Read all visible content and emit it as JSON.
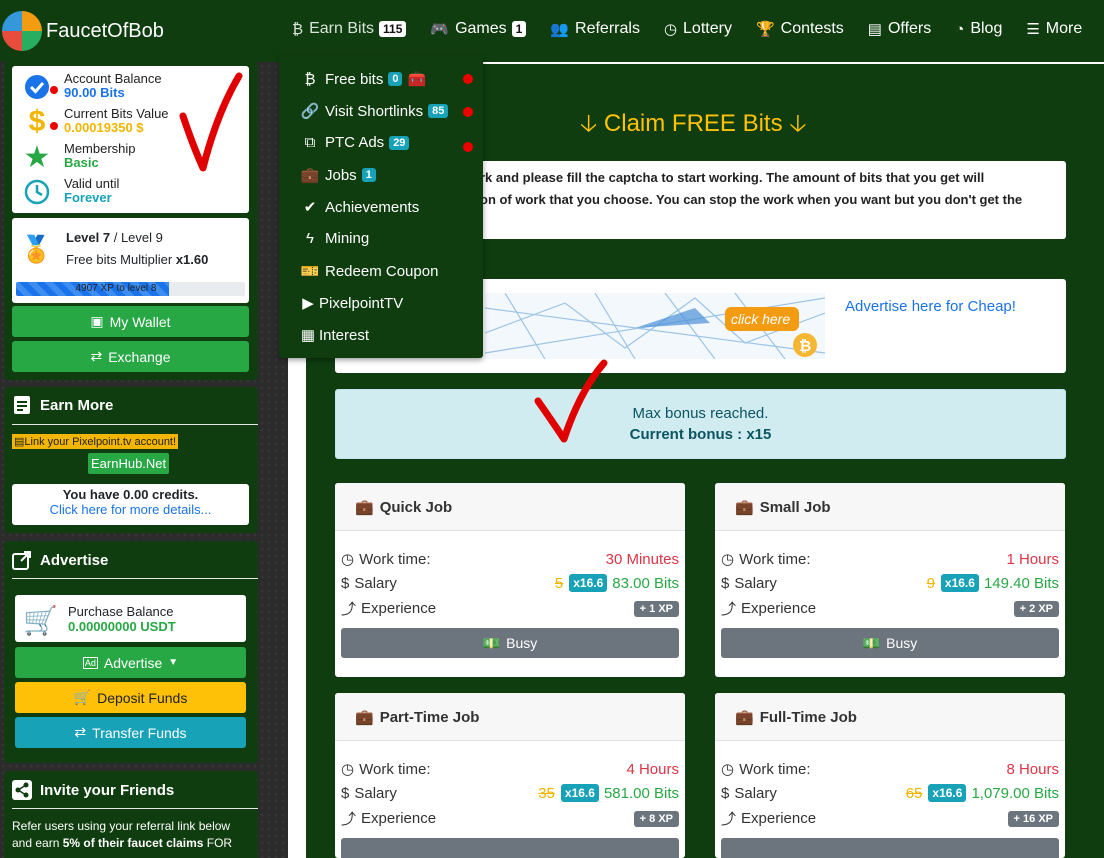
{
  "brand": {
    "name": "FaucetOfBob"
  },
  "nav": [
    {
      "label": "Earn Bits",
      "badge": "115",
      "icon": "bitcoin-icon"
    },
    {
      "label": "Games",
      "badge": "1",
      "icon": "gamepad-icon"
    },
    {
      "label": "Referrals",
      "icon": "users-icon"
    },
    {
      "label": "Lottery",
      "icon": "clock-icon"
    },
    {
      "label": "Contests",
      "icon": "trophy-icon"
    },
    {
      "label": "Offers",
      "icon": "list-icon"
    },
    {
      "label": "Blog",
      "icon": "rss-icon"
    },
    {
      "label": "More",
      "icon": "bars-icon"
    }
  ],
  "dropdown": [
    {
      "label": "Free bits",
      "badge": "0"
    },
    {
      "label": "Visit Shortlinks",
      "badge": "85"
    },
    {
      "label": "PTC Ads",
      "badge": "29"
    },
    {
      "label": "Jobs",
      "badge": "1"
    },
    {
      "label": "Achievements"
    },
    {
      "label": "Mining"
    },
    {
      "label": "Redeem Coupon"
    },
    {
      "label": "PixelpointTV"
    },
    {
      "label": "Interest"
    }
  ],
  "account": {
    "balance_label": "Account Balance",
    "balance_value": "90.00 Bits",
    "bits_value_label": "Current Bits Value",
    "bits_value": "0.00019350 $",
    "membership_label": "Membership",
    "membership_value": "Basic",
    "valid_label": "Valid until",
    "valid_value": "Forever"
  },
  "level": {
    "current": "Level 7",
    "sep": " / ",
    "next": "Level 9",
    "multiplier_label": "Free bits Multiplier ",
    "multiplier": "x1.60",
    "progress_text": "4907 XP to level 8",
    "progress": 0.67
  },
  "sidebar_buttons": {
    "wallet": "My Wallet",
    "exchange": "Exchange"
  },
  "earn_more": {
    "title": "Earn More",
    "pixelpoint": "Link your Pixelpoint.tv account!",
    "earnhub": "EarnHub.Net",
    "credits": "You have 0.00 credits.",
    "details": "Click here for more details..."
  },
  "advertise": {
    "title": "Advertise",
    "purchase_label": "Purchase Balance",
    "purchase_value": "0.00000000 USDT",
    "advertise_btn": "Advertise",
    "deposit_btn": "Deposit Funds",
    "transfer_btn": "Transfer Funds"
  },
  "invite": {
    "title": "Invite your Friends",
    "line1": "Refer users using your referral link below",
    "line2_a": "and earn ",
    "line2_b": "5% of their faucet claims",
    "line2_c": " FOR"
  },
  "main": {
    "claim_title": "Claim FREE Bits",
    "info_line1": "rk and please fill the captcha to start working. The amount of bits that you get will",
    "info_line2": "on of work that you choose. You can stop the work when you want but you don't get the",
    "ad_text": "Advertise here for Cheap!",
    "ad_click": "click here",
    "bonus_line1": "Max bonus reached.",
    "bonus_line2": "Current bonus : x15"
  },
  "job_labels": {
    "work": "Work time:",
    "salary": "Salary",
    "xp": "Experience",
    "busy": "Busy"
  },
  "jobs": [
    {
      "title": "Quick Job",
      "time": "30 Minutes",
      "base": "5",
      "mult": "x16.6",
      "salary": "83.00 Bits",
      "xp": "+ 1 XP"
    },
    {
      "title": "Small Job",
      "time": "1 Hours",
      "base": "9",
      "mult": "x16.6",
      "salary": "149.40 Bits",
      "xp": "+ 2 XP"
    },
    {
      "title": "Part-Time Job",
      "time": "4 Hours",
      "base": "35",
      "mult": "x16.6",
      "salary": "581.00 Bits",
      "xp": "+ 8 XP"
    },
    {
      "title": "Full-Time Job",
      "time": "8 Hours",
      "base": "65",
      "mult": "x16.6",
      "salary": "1,079.00 Bits",
      "xp": "+ 16 XP"
    }
  ],
  "colors": {
    "nav_bg": "#0f3d0f",
    "accent_green": "#28a745",
    "accent_yellow": "#ffc107",
    "accent_teal": "#17a2b8",
    "annotation_red": "#e00000"
  }
}
